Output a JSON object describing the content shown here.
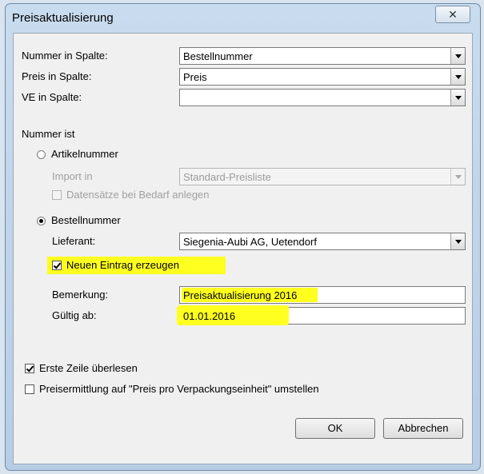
{
  "window": {
    "title": "Preisaktualisierung",
    "close_glyph": "✕"
  },
  "fields": {
    "nummer_label": "Nummer in Spalte:",
    "nummer_value": "Bestellnummer",
    "preis_label": "Preis in Spalte:",
    "preis_value": "Preis",
    "ve_label": "VE in Spalte:",
    "ve_value": ""
  },
  "nummer_ist": {
    "label": "Nummer ist",
    "artikel": {
      "label": "Artikelnummer",
      "import_label": "Import in",
      "import_value": "Standard-Preisliste",
      "datensaetze_label": "Datensätze bei Bedarf anlegen"
    },
    "bestell": {
      "label": "Bestellnummer",
      "lieferant_label": "Lieferant:",
      "lieferant_value": "Siegenia-Aubi AG, Uetendorf",
      "neuen_label": "Neuen Eintrag erzeugen",
      "bemerkung_label": "Bemerkung:",
      "bemerkung_value": "Preisaktualisierung 2016",
      "gueltig_label": "Gültig ab:",
      "gueltig_value": "01.01.2016"
    }
  },
  "options": {
    "erste_zeile": "Erste Zeile überlesen",
    "preisermittlung": "Preisermittlung auf \"Preis pro Verpackungseinheit\" umstellen"
  },
  "buttons": {
    "ok": "OK",
    "cancel": "Abbrechen"
  },
  "colors": {
    "highlight": "#ffff20"
  }
}
